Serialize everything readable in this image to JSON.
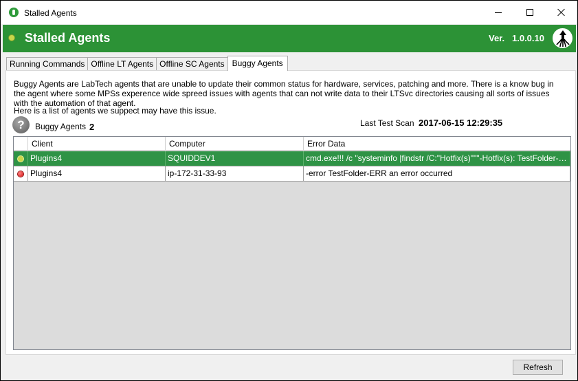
{
  "window": {
    "title": "Stalled Agents"
  },
  "header": {
    "title": "Stalled Agents",
    "version_label": "Ver.",
    "version_value": "1.0.0.10",
    "bg_color": "#2c9236"
  },
  "tabs": [
    {
      "label": "Running Commands",
      "active": false
    },
    {
      "label": "Offline LT Agents",
      "active": false
    },
    {
      "label": "Offline SC Agents",
      "active": false
    },
    {
      "label": "Buggy Agents",
      "active": true
    }
  ],
  "main": {
    "description": "Buggy Agents are LabTech agents that are unable to update their common status for hardware, services, patching and more. There is a know bug in the agent where some MPSs experence wide spreed issues with agents that can not write data to their LTSvc directories causing all sorts of issues with the automation of that agent.",
    "subdescription": "Here is a list of agents we suppect may have this issue.",
    "help_icon_glyph": "?",
    "count_label": "Buggy Agents",
    "count_value": "2",
    "last_scan_label": "Last Test Scan",
    "last_scan_value": "2017-06-15 12:29:35"
  },
  "grid": {
    "columns": [
      "Client",
      "Computer",
      "Error Data"
    ],
    "rows": [
      {
        "status": "warning",
        "status_color": "#c8d64a",
        "client": "Plugins4",
        "computer": "SQUIDDEV1",
        "error": "cmd.exe!!! /c \"systeminfo |findstr /C:\"Hotfix(s)\"\"\"-Hotfix(s):    TestFolder-ERR an error occurred",
        "selected": true
      },
      {
        "status": "error",
        "status_color": "#e02020",
        "client": "Plugins4",
        "computer": "ip-172-31-33-93",
        "error": "-error TestFolder-ERR an error occurred",
        "selected": false
      }
    ]
  },
  "footer": {
    "refresh_label": "Refresh"
  }
}
